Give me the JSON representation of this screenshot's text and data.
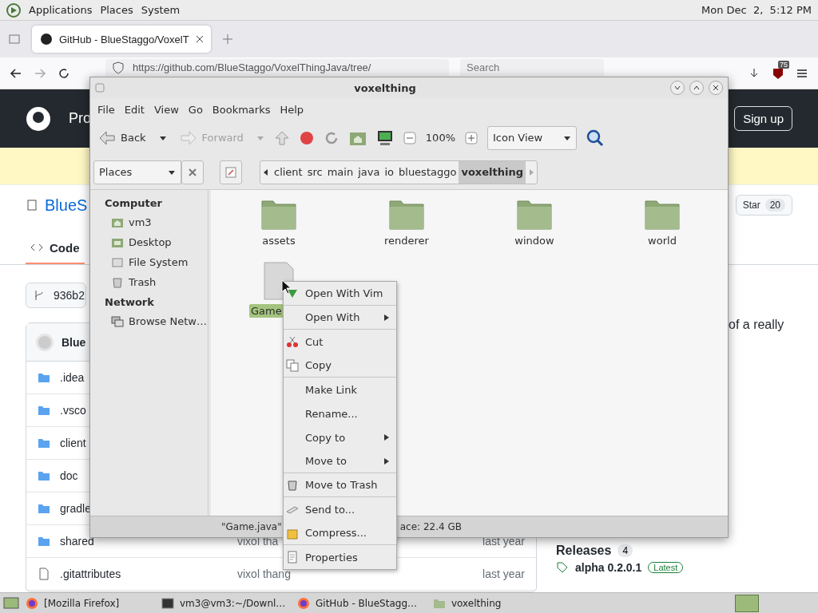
{
  "top_panel": {
    "menus": [
      "Applications",
      "Places",
      "System"
    ],
    "clock": "Mon Dec  2,  5:12 PM"
  },
  "browser": {
    "tabs": [
      {
        "title": "GitHub - BlueStaggo/VoxelT",
        "selected": true
      }
    ],
    "url": "https://github.com/BlueStaggo/VoxelThingJava/tree/",
    "search": {
      "placeholder": "Search"
    },
    "extension_badge": "75"
  },
  "github": {
    "header": {
      "nav_text": "Pro",
      "sign_up": "Sign up"
    },
    "repo": {
      "name": "BlueS",
      "star": "Star",
      "star_count": "20"
    },
    "tabs": [
      {
        "label": "Code",
        "selected": true
      }
    ],
    "branch": "936b2",
    "table": {
      "header": "Blue",
      "rows": [
        {
          "name": ".idea",
          "kind": "folder"
        },
        {
          "name": ".vsco",
          "kind": "folder"
        },
        {
          "name": "client",
          "kind": "folder"
        },
        {
          "name": "doc",
          "kind": "folder"
        },
        {
          "name": "gradle",
          "kind": "folder"
        },
        {
          "name": "shared",
          "kind": "folder",
          "commit": "vixol tha",
          "time": "last year"
        },
        {
          "name": ".gitattributes",
          "kind": "file",
          "commit": "vixol thang",
          "time": "last year"
        }
      ]
    },
    "about": "of a really",
    "releases": {
      "title": "Releases",
      "count": "4",
      "latest": {
        "name": "alpha 0.2.0.1",
        "badge": "Latest"
      }
    }
  },
  "file_manager": {
    "title": "voxelthing",
    "menu": [
      "File",
      "Edit",
      "View",
      "Go",
      "Bookmarks",
      "Help"
    ],
    "toolbar": {
      "back": {
        "label": "Back",
        "disabled": false
      },
      "forward": {
        "label": "Forward",
        "disabled": true
      },
      "zoom": "100%",
      "view": "Icon View"
    },
    "location": {
      "places": "Places",
      "path": [
        {
          "label": "client",
          "selected": false
        },
        {
          "label": "src",
          "selected": false
        },
        {
          "label": "main",
          "selected": false
        },
        {
          "label": "java",
          "selected": false
        },
        {
          "label": "io",
          "selected": false
        },
        {
          "label": "bluestaggo",
          "selected": false
        },
        {
          "label": "voxelthing",
          "selected": true
        }
      ]
    },
    "sidebar": [
      {
        "heading": "Computer",
        "items": [
          {
            "label": "vm3",
            "kind": "home"
          },
          {
            "label": "Desktop",
            "kind": "desktop"
          },
          {
            "label": "File System",
            "kind": "drive"
          },
          {
            "label": "Trash",
            "kind": "trash"
          }
        ]
      },
      {
        "heading": "Network",
        "items": [
          {
            "label": "Browse Netw…",
            "kind": "network"
          }
        ]
      }
    ],
    "items": [
      {
        "label": "assets",
        "kind": "folder",
        "selected": false
      },
      {
        "label": "renderer",
        "kind": "folder",
        "selected": false
      },
      {
        "label": "window",
        "kind": "folder",
        "selected": false
      },
      {
        "label": "world",
        "kind": "folder",
        "selected": false
      },
      {
        "label": "Game",
        "kind": "file",
        "selected": true
      }
    ],
    "status": [
      "\"Game.java\"",
      "ace: 22.4 GB"
    ]
  },
  "context_menu": [
    {
      "label": "Open With Vim",
      "kind": "vim",
      "submenu": false,
      "separator_after": true
    },
    {
      "label": "Open With",
      "kind": "plain",
      "submenu": true,
      "separator_after": true
    },
    {
      "label": "Cut",
      "kind": "cut",
      "submenu": false,
      "separator_after": false
    },
    {
      "label": "Copy",
      "kind": "copy",
      "submenu": false,
      "separator_after": true
    },
    {
      "label": "Make Link",
      "kind": "plain",
      "submenu": false,
      "separator_after": false
    },
    {
      "label": "Rename...",
      "kind": "plain",
      "submenu": false,
      "separator_after": false
    },
    {
      "label": "Copy to",
      "kind": "plain",
      "submenu": true,
      "separator_after": false
    },
    {
      "label": "Move to",
      "kind": "plain",
      "submenu": true,
      "separator_after": true
    },
    {
      "label": "Move to Trash",
      "kind": "trash",
      "submenu": false,
      "separator_after": true
    },
    {
      "label": "Send to...",
      "kind": "send",
      "submenu": false,
      "separator_after": false
    },
    {
      "label": "Compress...",
      "kind": "compress",
      "submenu": false,
      "separator_after": true
    },
    {
      "label": "Properties",
      "kind": "properties",
      "submenu": false,
      "separator_after": false
    }
  ],
  "taskbar": [
    {
      "label": "[Mozilla Firefox]",
      "kind": "firefox"
    },
    {
      "label": "vm3@vm3:~/Downl…",
      "kind": "terminal"
    },
    {
      "label": "GitHub - BlueStagg…",
      "kind": "firefox"
    },
    {
      "label": "voxelthing",
      "kind": "folder"
    }
  ]
}
